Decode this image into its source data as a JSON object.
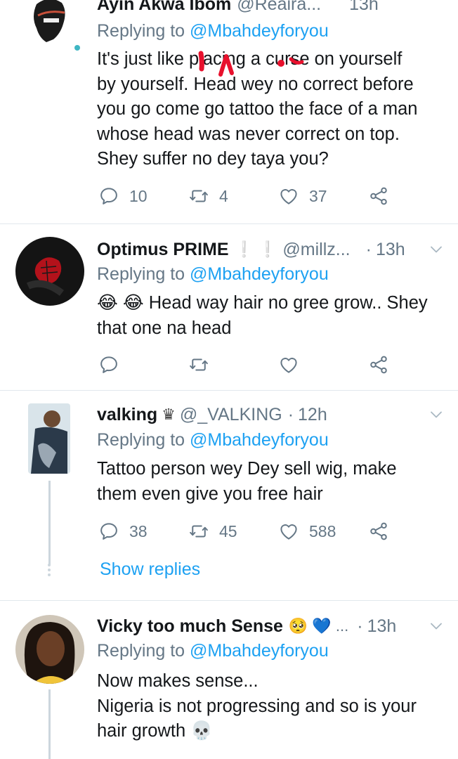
{
  "tweets": [
    {
      "name": "Ayin Akwa Ibom",
      "handle": "@Reaira...",
      "time": "13h",
      "replying_prefix": "Replying to",
      "replying_to": "@Mbahdeyforyou",
      "lines": [
        "It's just like placing a curse on yourself",
        "by yourself. Head wey no correct before",
        "you go come go tattoo the face of a man",
        "whose head was never correct on top.",
        "Shey suffer no dey taya you?"
      ],
      "replies": "10",
      "retweets": "4",
      "likes": "37"
    },
    {
      "name": "Optimus PRIME",
      "badge": "❕ ❕",
      "handle": "@millz...",
      "dot": "·",
      "time": "13h",
      "replying_prefix": "Replying to",
      "replying_to": "@Mbahdeyforyou",
      "lines": [
        "😂 😂 Head way hair no gree grow.. Shey",
        "that one na head"
      ],
      "replies": "",
      "retweets": "",
      "likes": ""
    },
    {
      "name": "valking",
      "badge": "♛",
      "handle": "@_VALKING",
      "dot": "·",
      "time": "12h",
      "replying_prefix": "Replying to",
      "replying_to": "@Mbahdeyforyou",
      "lines": [
        "Tattoo person wey Dey sell wig, make",
        "them even give you free hair"
      ],
      "replies": "38",
      "retweets": "45",
      "likes": "588",
      "show_replies": "Show replies"
    },
    {
      "name": "Vicky too much Sense",
      "badge": "🥺 💙 ...",
      "dot": "·",
      "time": "13h",
      "replying_prefix": "Replying to",
      "replying_to": "@Mbahdeyforyou",
      "lines": [
        "Now makes sense...",
        "Nigeria is not progressing and so is your",
        "hair growth 💀"
      ]
    }
  ],
  "colors": {
    "text": "#14171a",
    "secondary": "#657786",
    "link": "#1da1f2",
    "divider": "#e1e8ed",
    "scribble": "#e8112d"
  },
  "icons": [
    "reply-icon",
    "retweet-icon",
    "like-icon",
    "share-icon",
    "chevron-down-icon"
  ]
}
